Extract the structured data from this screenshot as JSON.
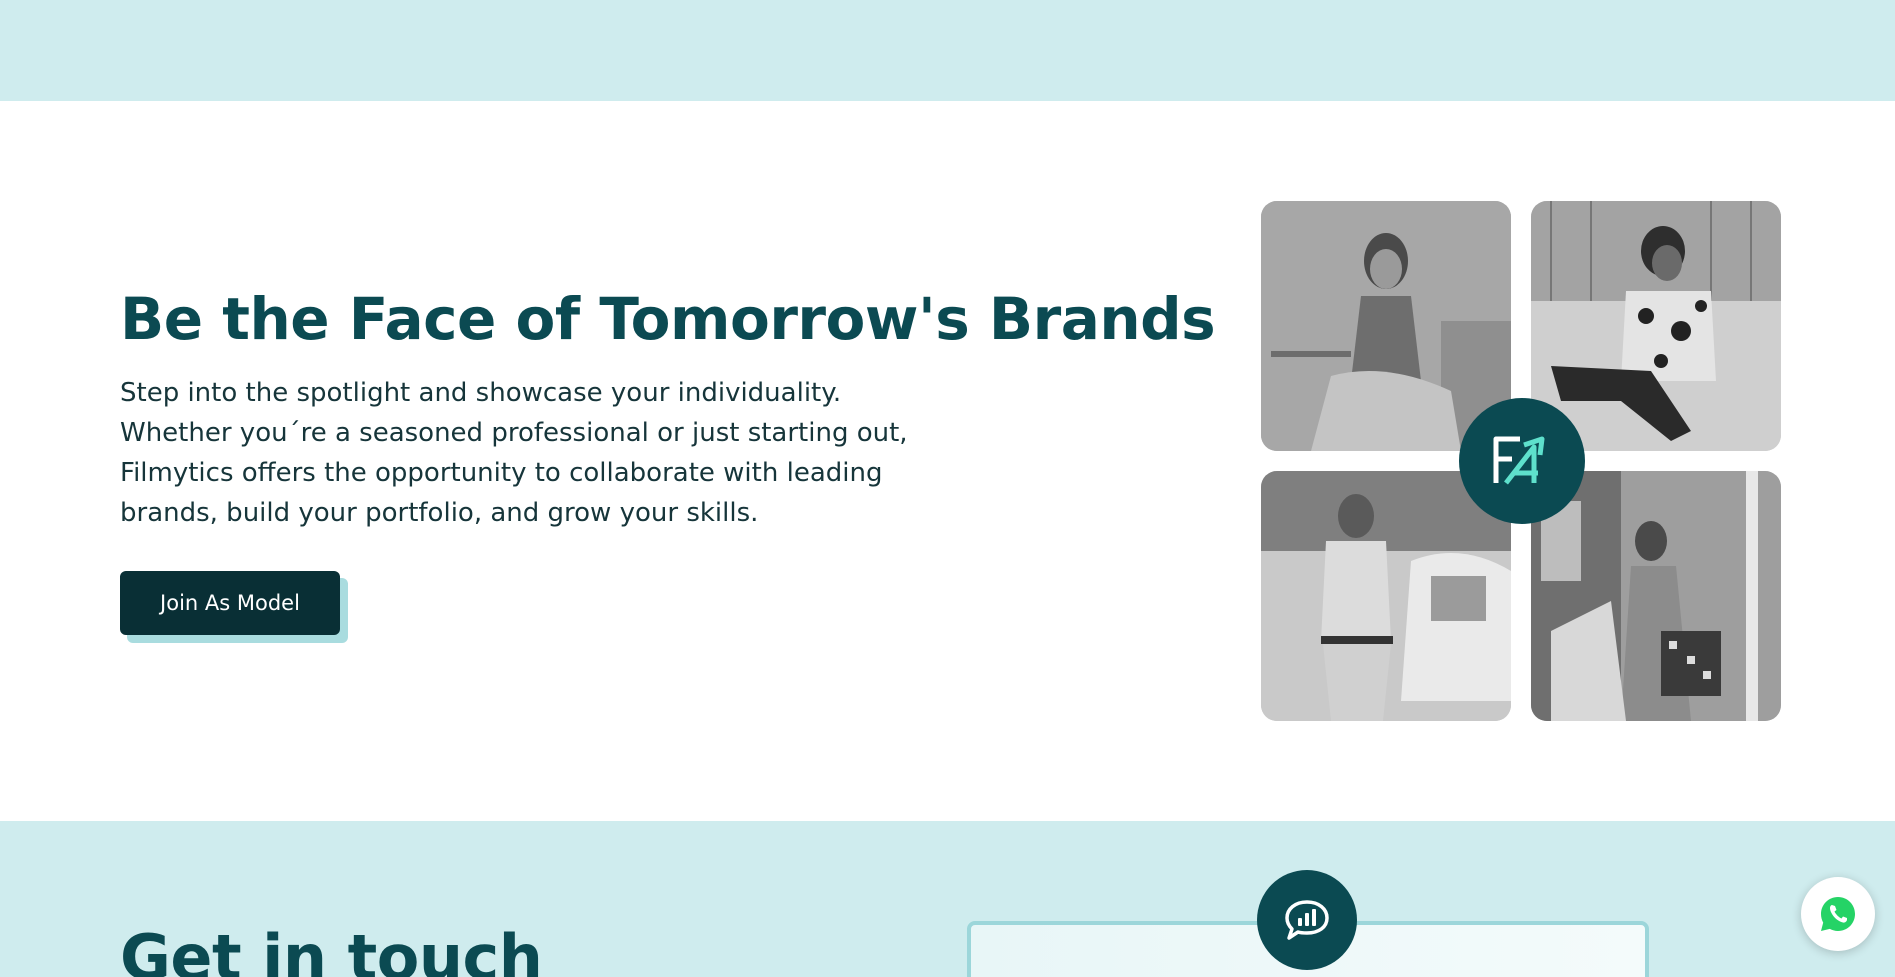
{
  "hero": {
    "title": "Be the Face of Tomorrow's Brands",
    "description": "Step into the spotlight and showcase your individuality. Whether you´re a seasoned professional or just starting out, Filmytics offers the opportunity to collaborate with leading brands, build your portfolio, and grow your skills.",
    "cta_label": "Join As Model"
  },
  "gallery": {
    "photos": [
      {
        "subject": "woman-seated-portrait"
      },
      {
        "subject": "man-seated-patterned-shirt"
      },
      {
        "subject": "man-standing-by-car"
      },
      {
        "subject": "woman-with-bag"
      }
    ],
    "badge_icon": "filmytics-logo-icon"
  },
  "contact": {
    "title": "Get in touch",
    "badge_icon": "chat-analytics-icon"
  },
  "floating": {
    "whatsapp_icon": "whatsapp-icon"
  },
  "colors": {
    "brand_dark": "#0b4a52",
    "button_dark": "#092f35",
    "accent_light": "#cfecee",
    "logo_accent": "#5ee0cc",
    "whatsapp_green": "#25d366"
  }
}
